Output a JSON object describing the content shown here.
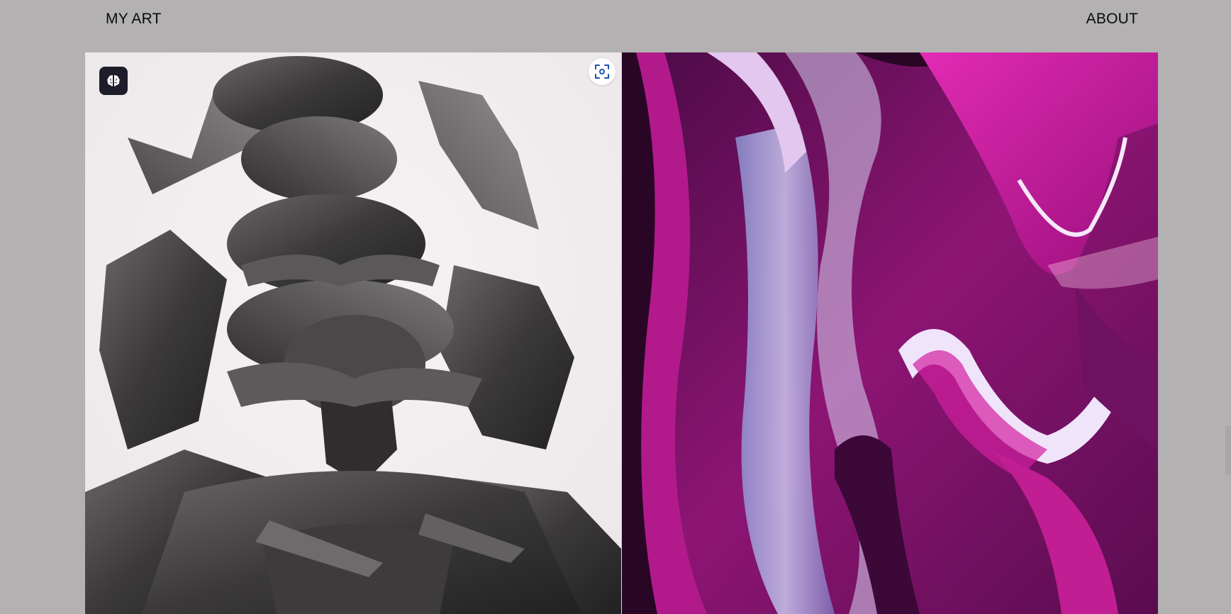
{
  "header": {
    "brand_label": "MY ART",
    "about_label": "ABOUT"
  },
  "gallery": {
    "items": [
      {
        "icon": "brain-icon",
        "action_icon": "scan-focus-icon",
        "tone": "monochrome"
      },
      {
        "tone": "magenta"
      }
    ]
  },
  "colors": {
    "background": "#b3b1b2",
    "badge": "#1d1d2b",
    "scan_button": "#ffffff",
    "magenta": "#c0168f",
    "deep_purple": "#3a0a3a"
  }
}
